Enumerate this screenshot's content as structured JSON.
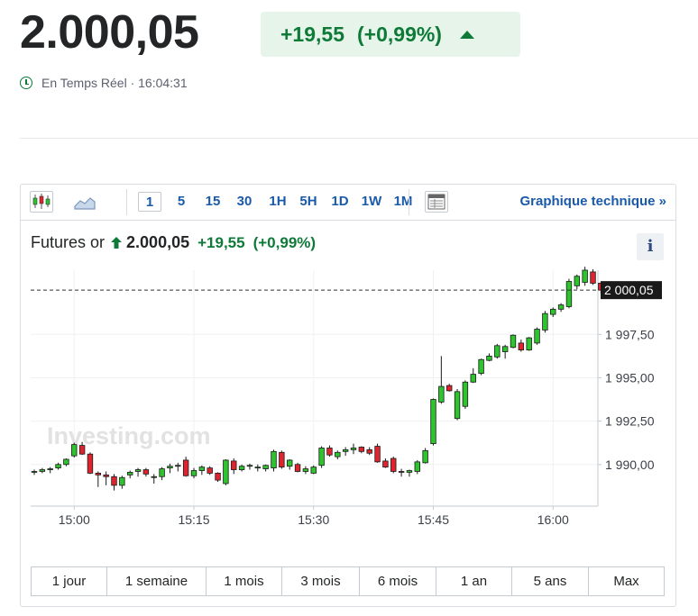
{
  "header": {
    "price": "2.000,05",
    "change_abs": "+19,55",
    "change_pct": "(+0,99%)",
    "realtime_label": "En Temps Réel · 16:04:31"
  },
  "toolbar": {
    "timeframes": [
      "1",
      "5",
      "15",
      "30",
      "1H",
      "5H",
      "1D",
      "1W",
      "1M"
    ],
    "selected_timeframe": "1",
    "technical_label": "Graphique technique »"
  },
  "legend": {
    "name": "Futures or",
    "price": "2.000,05",
    "change": "+19,55",
    "pct": "(+0,99%)"
  },
  "info_icon": "i",
  "watermark": "Investing.com",
  "range_buttons": [
    "1 jour",
    "1 semaine",
    "1 mois",
    "3 mois",
    "6 mois",
    "1 an",
    "5 ans",
    "Max"
  ],
  "colors": {
    "up": "#2ec42e",
    "down": "#e0242e",
    "accent": "#1a5aa8",
    "positive_text": "#0e7a38",
    "positive_bg": "#e6f4ea"
  },
  "chart_data": {
    "type": "candlestick",
    "x_ticks": [
      "15:00",
      "15:15",
      "15:30",
      "15:45",
      "16:00"
    ],
    "y_ticks": [
      "1 990,00",
      "1 992,50",
      "1 995,00",
      "1 997,50"
    ],
    "y_tick_values": [
      1990.0,
      1992.5,
      1995.0,
      1997.5
    ],
    "ylim": [
      1987.6,
      2001.2
    ],
    "current_price_label": "2 000,05",
    "current_price": 2000.05,
    "first_candle_time": "14:55",
    "interval_minutes": 1,
    "grid": true,
    "candles": [
      [
        1989.55,
        1989.7,
        1989.4,
        1989.6
      ],
      [
        1989.6,
        1989.8,
        1989.5,
        1989.7
      ],
      [
        1989.7,
        1989.85,
        1989.5,
        1989.75
      ],
      [
        1989.8,
        1990.1,
        1989.7,
        1990.0
      ],
      [
        1990.0,
        1990.35,
        1989.9,
        1990.3
      ],
      [
        1990.5,
        1991.25,
        1990.4,
        1991.15
      ],
      [
        1991.1,
        1991.3,
        1990.55,
        1990.6
      ],
      [
        1990.6,
        1990.7,
        1989.45,
        1989.5
      ],
      [
        1989.5,
        1989.6,
        1988.7,
        1989.4
      ],
      [
        1989.4,
        1989.6,
        1988.8,
        1989.3
      ],
      [
        1989.3,
        1989.45,
        1988.5,
        1988.8
      ],
      [
        1988.8,
        1989.35,
        1988.6,
        1989.25
      ],
      [
        1989.4,
        1989.65,
        1989.2,
        1989.55
      ],
      [
        1989.6,
        1989.8,
        1989.3,
        1989.7
      ],
      [
        1989.7,
        1989.8,
        1989.3,
        1989.45
      ],
      [
        1989.3,
        1989.45,
        1988.9,
        1989.3
      ],
      [
        1989.3,
        1989.85,
        1989.1,
        1989.75
      ],
      [
        1989.8,
        1990.05,
        1989.5,
        1989.9
      ],
      [
        1989.9,
        1990.1,
        1989.6,
        1989.95
      ],
      [
        1990.25,
        1990.45,
        1989.3,
        1989.35
      ],
      [
        1989.35,
        1989.8,
        1989.2,
        1989.65
      ],
      [
        1989.65,
        1989.95,
        1989.4,
        1989.85
      ],
      [
        1989.8,
        1989.9,
        1989.4,
        1989.5
      ],
      [
        1989.5,
        1989.55,
        1989.0,
        1989.1
      ],
      [
        1988.9,
        1990.3,
        1988.8,
        1990.25
      ],
      [
        1990.2,
        1990.35,
        1989.45,
        1989.7
      ],
      [
        1989.7,
        1990.0,
        1989.6,
        1989.9
      ],
      [
        1989.9,
        1990.05,
        1989.7,
        1989.95
      ],
      [
        1989.8,
        1990.0,
        1989.6,
        1989.85
      ],
      [
        1989.75,
        1990.0,
        1989.6,
        1989.95
      ],
      [
        1989.8,
        1990.85,
        1989.6,
        1990.75
      ],
      [
        1990.7,
        1990.8,
        1989.75,
        1989.85
      ],
      [
        1989.9,
        1990.3,
        1989.7,
        1990.25
      ],
      [
        1990.0,
        1990.1,
        1989.55,
        1989.6
      ],
      [
        1989.6,
        1989.9,
        1989.45,
        1989.75
      ],
      [
        1989.5,
        1989.95,
        1989.45,
        1989.85
      ],
      [
        1989.95,
        1991.05,
        1989.8,
        1990.95
      ],
      [
        1990.95,
        1991.1,
        1990.45,
        1990.55
      ],
      [
        1990.45,
        1990.8,
        1990.3,
        1990.7
      ],
      [
        1990.75,
        1991.0,
        1990.5,
        1990.85
      ],
      [
        1990.85,
        1991.2,
        1990.6,
        1990.95
      ],
      [
        1991.0,
        1991.05,
        1990.65,
        1990.75
      ],
      [
        1990.85,
        1991.0,
        1990.55,
        1990.65
      ],
      [
        1991.05,
        1991.2,
        1990.1,
        1990.15
      ],
      [
        1990.2,
        1990.35,
        1989.8,
        1989.85
      ],
      [
        1990.35,
        1990.45,
        1989.5,
        1989.6
      ],
      [
        1989.6,
        1989.75,
        1989.3,
        1989.55
      ],
      [
        1989.55,
        1989.7,
        1989.3,
        1989.65
      ],
      [
        1989.6,
        1990.25,
        1989.45,
        1990.15
      ],
      [
        1990.1,
        1990.95,
        1990.05,
        1990.8
      ],
      [
        1991.2,
        1993.8,
        1991.1,
        1993.75
      ],
      [
        1993.6,
        1996.25,
        1993.5,
        1994.5
      ],
      [
        1994.55,
        1994.65,
        1994.2,
        1994.25
      ],
      [
        1992.65,
        1994.35,
        1992.55,
        1994.2
      ],
      [
        1993.35,
        1994.85,
        1993.2,
        1994.75
      ],
      [
        1994.75,
        1995.55,
        1994.7,
        1995.2
      ],
      [
        1995.25,
        1996.1,
        1995.15,
        1996.05
      ],
      [
        1996.0,
        1996.4,
        1995.95,
        1996.25
      ],
      [
        1996.2,
        1996.95,
        1996.1,
        1996.85
      ],
      [
        1996.5,
        1996.9,
        1996.1,
        1996.8
      ],
      [
        1996.75,
        1997.5,
        1996.7,
        1997.45
      ],
      [
        1997.0,
        1997.2,
        1996.5,
        1996.6
      ],
      [
        1996.6,
        1997.35,
        1996.55,
        1997.3
      ],
      [
        1997.0,
        1997.9,
        1996.9,
        1997.8
      ],
      [
        1997.75,
        1998.85,
        1997.6,
        1998.7
      ],
      [
        1998.65,
        1999.05,
        1998.5,
        1998.95
      ],
      [
        1998.95,
        1999.3,
        1998.8,
        1999.2
      ],
      [
        1999.1,
        2000.7,
        1999.0,
        2000.55
      ],
      [
        2000.3,
        2000.95,
        2000.1,
        2000.85
      ],
      [
        2000.5,
        2001.4,
        2000.3,
        2001.2
      ],
      [
        2001.1,
        2001.25,
        2000.35,
        2000.45
      ],
      [
        2000.45,
        2000.5,
        1999.85,
        2000.05
      ]
    ]
  }
}
